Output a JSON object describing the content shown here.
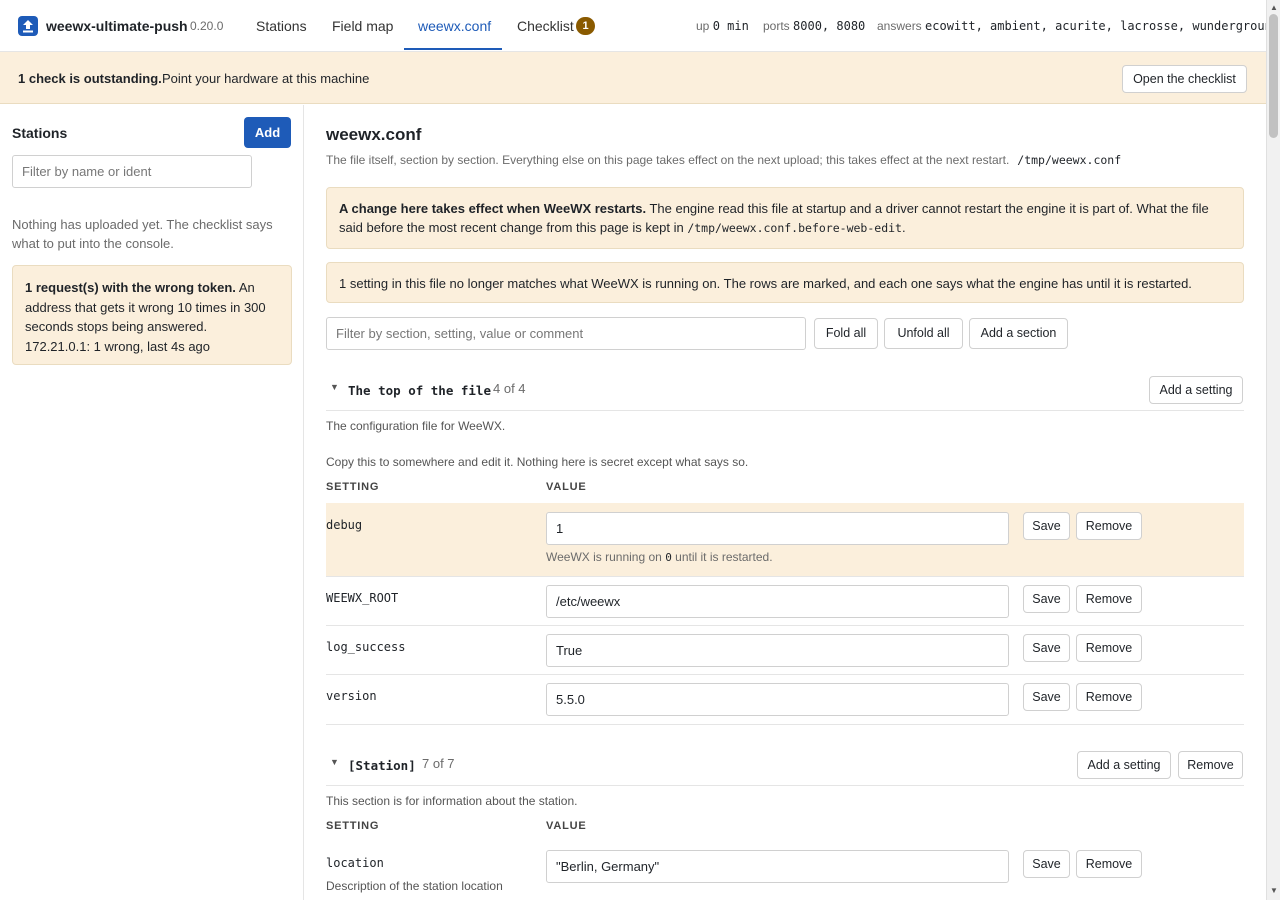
{
  "app": {
    "name": "weewx-ultimate-push",
    "version": "0.20.0"
  },
  "tabs": [
    {
      "label": "Stations"
    },
    {
      "label": "Field map"
    },
    {
      "label": "weewx.conf"
    },
    {
      "label": "Checklist",
      "badge": "1"
    }
  ],
  "status": {
    "uptime_label": "up",
    "uptime_value": "0 min",
    "ports_label": "ports",
    "ports_value": "8000, 8080",
    "answers_label": "answers",
    "answers_value": "ecowitt, ambient, acurite, lacrosse, wunderground"
  },
  "banner": {
    "strong": "1 check is outstanding.",
    "text": "Point your hardware at this machine",
    "button": "Open the checklist"
  },
  "sidebar": {
    "title": "Stations",
    "add_label": "Add",
    "filter_placeholder": "Filter by name or ident",
    "empty_text": "Nothing has uploaded yet. The checklist says what to put into the console.",
    "warn_strong": "1 request(s) with the wrong token.",
    "warn_text": "An address that gets it wrong 10 times in 300 seconds stops being answered.",
    "warn_detail": "172.21.0.1: 1 wrong, last 4s ago"
  },
  "main": {
    "title": "weewx.conf",
    "subtitle": "The file itself, section by section. Everything else on this page takes effect on the next upload; this takes effect at the next restart.",
    "path": "/tmp/weewx.conf",
    "restart_note_strong": "A change here takes effect when WeeWX restarts.",
    "restart_note_text": "The engine read this file at startup and a driver cannot restart the engine it is part of. What the file said before the most recent change from this page is kept in",
    "restart_note_path": "/tmp/weewx.conf.before-web-edit",
    "restart_note_end": ".",
    "mismatch_note": "1 setting in this file no longer matches what WeeWX is running on. The rows are marked, and each one says what the engine has until it is restarted.",
    "filter_placeholder": "Filter by section, setting, value or comment",
    "fold_all": "Fold all",
    "unfold_all": "Unfold all",
    "add_section": "Add a section",
    "col_setting": "SETTING",
    "col_value": "VALUE",
    "save_label": "Save",
    "remove_label": "Remove",
    "add_setting_label": "Add a setting",
    "sections": [
      {
        "name": "The top of the file",
        "count": "4 of 4",
        "comment1": "The configuration file for WeeWX.",
        "comment2": "Copy this to somewhere and edit it. Nothing here is secret except what says so.",
        "rows": [
          {
            "key": "debug",
            "value": "1",
            "help_pre": "WeeWX is running on",
            "help_val": "0",
            "help_post": "until it is restarted."
          },
          {
            "key": "WEEWX_ROOT",
            "value": "/etc/weewx"
          },
          {
            "key": "log_success",
            "value": "True"
          },
          {
            "key": "version",
            "value": "5.5.0"
          }
        ]
      },
      {
        "name": "[Station]",
        "count": "7 of 7",
        "comment1": "This section is for information about the station.",
        "rows": [
          {
            "key": "location",
            "value": "\"Berlin, Germany\"",
            "desc": "Description of the station location"
          }
        ]
      }
    ]
  },
  "icons": {
    "logo": "upload-icon",
    "caret": "caret-down-icon"
  },
  "colors": {
    "accent": "#1e5bb8",
    "warn_bg": "#fbefdc",
    "badge": "#8a5a00"
  }
}
